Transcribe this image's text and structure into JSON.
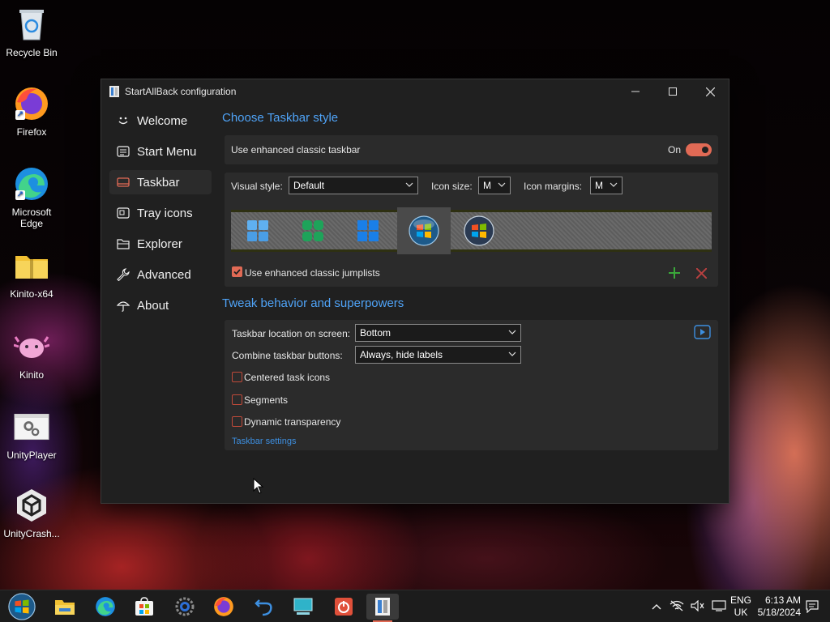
{
  "desktop": {
    "icons": [
      {
        "label": "Recycle Bin",
        "icon": "recycle-bin-icon"
      },
      {
        "label": "Firefox",
        "icon": "firefox-icon"
      },
      {
        "label": "Microsoft Edge",
        "icon": "edge-icon"
      },
      {
        "label": "Kinito-x64",
        "icon": "zip-folder-icon"
      },
      {
        "label": "Kinito",
        "icon": "axolotl-icon"
      },
      {
        "label": "UnityPlayer",
        "icon": "settings-file-icon"
      },
      {
        "label": "UnityCrash...",
        "icon": "unity-icon"
      }
    ]
  },
  "window": {
    "title": "StartAllBack configuration",
    "controls": [
      "minimize-icon",
      "maximize-icon",
      "close-icon"
    ]
  },
  "sidebar": {
    "items": [
      {
        "label": "Welcome",
        "icon": "smile-icon",
        "active": false
      },
      {
        "label": "Start Menu",
        "icon": "start-menu-icon",
        "active": false
      },
      {
        "label": "Taskbar",
        "icon": "taskbar-icon",
        "active": true
      },
      {
        "label": "Tray icons",
        "icon": "tray-icon",
        "active": false
      },
      {
        "label": "Explorer",
        "icon": "folder-icon",
        "active": false
      },
      {
        "label": "Advanced",
        "icon": "wrench-icon",
        "active": false
      },
      {
        "label": "About",
        "icon": "umbrella-icon",
        "active": false
      }
    ]
  },
  "taskbar_style": {
    "heading": "Choose Taskbar style",
    "enhanced_label": "Use enhanced classic taskbar",
    "toggle_state": "On",
    "toggle_on": true,
    "visual_style_label": "Visual style:",
    "visual_style_value": "Default",
    "icon_size_label": "Icon size:",
    "icon_size_value": "M",
    "icon_margins_label": "Icon margins:",
    "icon_margins_value": "M",
    "styles": [
      "windows-11-icon",
      "windows-11-green-icon",
      "windows-10-icon",
      "windows-7-orb-icon",
      "windows-vista-orb-icon"
    ],
    "selected_style": 3,
    "jumplists_label": "Use enhanced classic jumplists",
    "jumplists_checked": true,
    "add_icon": "plus-icon",
    "remove_icon": "x-icon",
    "colors": {
      "accent": "#e16a55",
      "heading": "#4fa3f7",
      "add": "#3aa83a",
      "remove": "#b84040"
    }
  },
  "tweaks": {
    "heading": "Tweak behavior and superpowers",
    "location_label": "Taskbar location on screen:",
    "location_value": "Bottom",
    "combine_label": "Combine taskbar buttons:",
    "combine_value": "Always, hide labels",
    "centered_label": "Centered task icons",
    "segments_label": "Segments",
    "transparency_label": "Dynamic transparency",
    "settings_link": "Taskbar settings",
    "video_icon": "play-video-icon"
  },
  "taskbar": {
    "apps": [
      "windows-7-start-icon",
      "file-explorer-icon",
      "edge-icon",
      "store-icon",
      "settings-icon",
      "firefox-icon",
      "undo-app-icon",
      "desktop-app-icon",
      "power-app-icon",
      "startallback-icon"
    ],
    "active_index": 9,
    "tray_icons": [
      "chevron-up-icon",
      "network-off-icon",
      "volume-icon",
      "display-icon"
    ],
    "lang_top": "ENG",
    "lang_bottom": "UK",
    "time": "6:13 AM",
    "date": "5/18/2024",
    "notification_icon": "notification-icon"
  }
}
